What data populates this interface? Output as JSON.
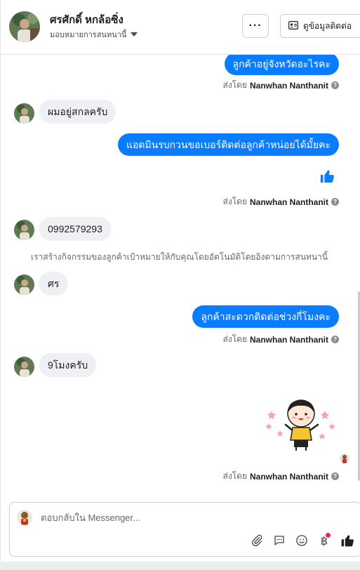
{
  "header": {
    "contact_name": "ศรศักดิ์ หกล้อซิ่ง",
    "assign_label": "มอบหมายการสนทนานี้",
    "more_label": "···",
    "view_contact_label": "ดูข้อมูลติดต่อ"
  },
  "messages": [
    {
      "type": "outgoing",
      "text": "ลูกค้าอยู่จังหวัดอะไรคะ"
    },
    {
      "type": "sent_by",
      "prefix": "ส่งโดย",
      "name": "Nanwhan Nanthanit"
    },
    {
      "type": "incoming",
      "text": "ผมอยู่สกลครับ"
    },
    {
      "type": "outgoing",
      "text": "แอดมินรบกวนขอเบอร์ติดต่อลูกค้าหน่อยได้มั้ยคะ"
    },
    {
      "type": "like"
    },
    {
      "type": "sent_by",
      "prefix": "ส่งโดย",
      "name": "Nanwhan Nanthanit"
    },
    {
      "type": "incoming",
      "text": "0992579293"
    },
    {
      "type": "system",
      "text": "เราสร้างกิจกรรมของลูกค้าเป้าหมายให้กับคุณโดยอัตโนมัติโดยอิงตามการสนทนานี้"
    },
    {
      "type": "incoming",
      "text": "ศร"
    },
    {
      "type": "outgoing",
      "text": "ลูกค้าสะดวกติดต่อช่วงกี่โมงคะ"
    },
    {
      "type": "sent_by",
      "prefix": "ส่งโดย",
      "name": "Nanwhan Nanthanit"
    },
    {
      "type": "incoming",
      "text": "9โมงครับ"
    },
    {
      "type": "sticker",
      "icon": "girl-waving-sticker"
    },
    {
      "type": "sent_by",
      "prefix": "ส่งโดย",
      "name": "Nanwhan Nanthanit"
    }
  ],
  "composer": {
    "placeholder": "ตอบกลับใน Messenger...",
    "tools": [
      "paperclip-icon",
      "speech-bubble-icon",
      "smiley-icon",
      "baht-icon",
      "like-icon"
    ]
  },
  "colors": {
    "accent": "#0a7cff",
    "incoming_bg": "#eef0f3",
    "notification": "#f02849"
  }
}
